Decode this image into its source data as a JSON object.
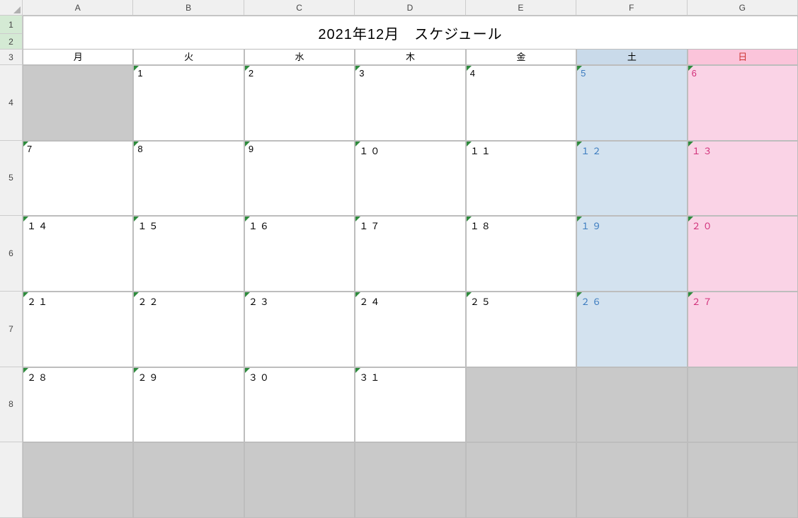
{
  "columns": [
    "A",
    "B",
    "C",
    "D",
    "E",
    "F",
    "G"
  ],
  "rows": [
    "1",
    "2",
    "3",
    "4",
    "5",
    "6",
    "7",
    "8"
  ],
  "title": "2021年12月　スケジュール",
  "dayHeaders": [
    "月",
    "火",
    "水",
    "木",
    "金",
    "土",
    "日"
  ],
  "weeks": [
    [
      {
        "n": "",
        "cls": "grey",
        "tri": false
      },
      {
        "n": "1",
        "cls": "",
        "tri": true
      },
      {
        "n": "2",
        "cls": "",
        "tri": true
      },
      {
        "n": "3",
        "cls": "",
        "tri": true
      },
      {
        "n": "4",
        "cls": "",
        "tri": true
      },
      {
        "n": "5",
        "cls": "sat",
        "tri": true
      },
      {
        "n": "6",
        "cls": "sun",
        "tri": true
      }
    ],
    [
      {
        "n": "7",
        "cls": "",
        "tri": true
      },
      {
        "n": "8",
        "cls": "",
        "tri": true
      },
      {
        "n": "9",
        "cls": "",
        "tri": true
      },
      {
        "n": "１０",
        "cls": "",
        "tri": true
      },
      {
        "n": "１１",
        "cls": "",
        "tri": true
      },
      {
        "n": "１２",
        "cls": "sat",
        "tri": true
      },
      {
        "n": "１３",
        "cls": "sun",
        "tri": true
      }
    ],
    [
      {
        "n": "１４",
        "cls": "",
        "tri": true
      },
      {
        "n": "１５",
        "cls": "",
        "tri": true
      },
      {
        "n": "１６",
        "cls": "",
        "tri": true
      },
      {
        "n": "１７",
        "cls": "",
        "tri": true
      },
      {
        "n": "１８",
        "cls": "",
        "tri": true
      },
      {
        "n": "１９",
        "cls": "sat",
        "tri": true
      },
      {
        "n": "２０",
        "cls": "sun",
        "tri": true
      }
    ],
    [
      {
        "n": "２１",
        "cls": "",
        "tri": true
      },
      {
        "n": "２２",
        "cls": "",
        "tri": true
      },
      {
        "n": "２３",
        "cls": "",
        "tri": true
      },
      {
        "n": "２４",
        "cls": "",
        "tri": true
      },
      {
        "n": "２５",
        "cls": "",
        "tri": true
      },
      {
        "n": "２６",
        "cls": "sat",
        "tri": true
      },
      {
        "n": "２７",
        "cls": "sun",
        "tri": true
      }
    ],
    [
      {
        "n": "２８",
        "cls": "",
        "tri": true
      },
      {
        "n": "２９",
        "cls": "",
        "tri": true
      },
      {
        "n": "３０",
        "cls": "",
        "tri": true
      },
      {
        "n": "３１",
        "cls": "",
        "tri": true
      },
      {
        "n": "",
        "cls": "grey",
        "tri": false
      },
      {
        "n": "",
        "cls": "grey",
        "tri": false
      },
      {
        "n": "",
        "cls": "grey",
        "tri": false
      }
    ],
    [
      {
        "n": "",
        "cls": "grey",
        "tri": false
      },
      {
        "n": "",
        "cls": "grey",
        "tri": false
      },
      {
        "n": "",
        "cls": "grey",
        "tri": false
      },
      {
        "n": "",
        "cls": "grey",
        "tri": false
      },
      {
        "n": "",
        "cls": "grey",
        "tri": false
      },
      {
        "n": "",
        "cls": "grey",
        "tri": false
      },
      {
        "n": "",
        "cls": "grey",
        "tri": false
      }
    ]
  ]
}
